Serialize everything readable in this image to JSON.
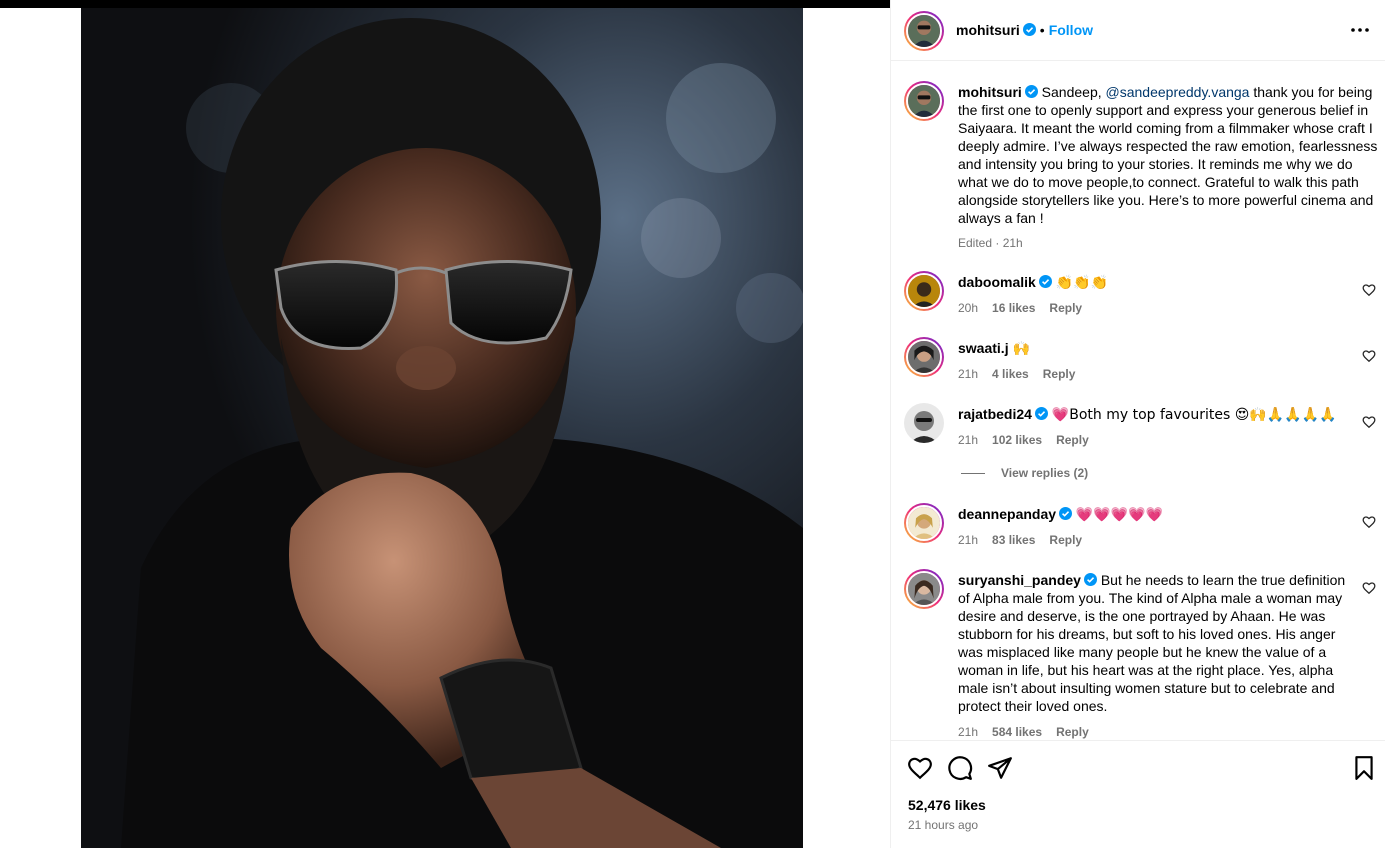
{
  "post": {
    "username": "mohitsuri",
    "follow_label": "Follow",
    "header_separator": "•"
  },
  "caption": {
    "username": "mohitsuri",
    "prefix": "Sandeep, ",
    "mention": "@sandeepreddy.vanga",
    "text": " thank you for being the first one to openly support and express your generous belief in Saiyaara. It meant the world coming from a filmmaker whose craft I deeply admire. I’ve always respected the raw emotion, fearlessness and intensity you bring to your stories. It reminds me why we do what we do to move people,to connect. Grateful to walk this path alongside storytellers like you. Here’s to more powerful cinema and always a fan !",
    "meta": "Edited · 21h"
  },
  "comments": [
    {
      "username": "daboomalik",
      "text": "👏👏👏",
      "time": "20h",
      "likes": "16 likes",
      "reply": "Reply"
    },
    {
      "username": "swaati.j",
      "text": "🙌",
      "time": "21h",
      "likes": "4 likes",
      "reply": "Reply"
    },
    {
      "username": "rajatbedi24",
      "text": "💗Both my top favourites 😍🙌🙏🙏🙏🙏",
      "time": "21h",
      "likes": "102 likes",
      "reply": "Reply"
    },
    {
      "username": "deannepanday",
      "text": "💗💗💗💗💗",
      "time": "21h",
      "likes": "83 likes",
      "reply": "Reply"
    },
    {
      "username": "suryanshi_pandey",
      "text": "But he needs to learn the true definition of Alpha male from you. The kind of Alpha male a woman may desire and deserve, is the one portrayed by Ahaan. He was stubborn for his dreams, but soft to his loved ones. His anger was misplaced like many people but he knew the value of a woman in life, but his heart was at the right place. Yes, alpha male isn’t about insulting women stature but to celebrate and protect their loved ones.",
      "time": "21h",
      "likes": "584 likes",
      "reply": "Reply"
    }
  ],
  "view_replies": "View replies (2)",
  "footer": {
    "likes": "52,476 likes",
    "time_ago": "21 hours ago"
  },
  "icons": {
    "verified": "verified-badge-icon",
    "more": "more-options-icon",
    "like": "heart-icon",
    "comment": "comment-icon",
    "share": "share-icon",
    "save": "bookmark-icon"
  },
  "colors": {
    "accent": "#0095f6",
    "verified": "#0095f6",
    "muted": "#737373",
    "mention": "#00376b"
  }
}
